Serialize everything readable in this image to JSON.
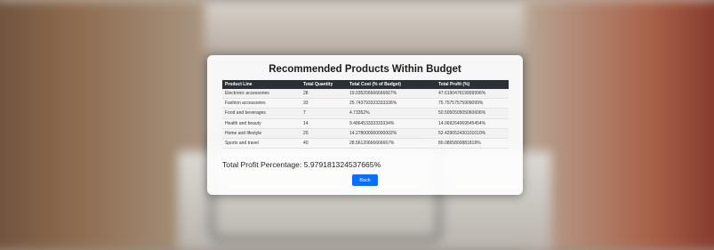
{
  "page": {
    "title": "Recommended Products Within Budget",
    "total_profit_label": "Total Profit Percentage: 5.979181324537665%",
    "back_label": "Back"
  },
  "table": {
    "headers": [
      "Product Line",
      "Total Quantity",
      "Total Cost (% of Budget)",
      "Total Profit (%)"
    ],
    "rows": [
      [
        "Electronic accessories",
        "28",
        "19.035206666666667%",
        "47.619047619999996%"
      ],
      [
        "Fashion accessories",
        "33",
        "25.743793333333336%",
        "75.75757575909099%"
      ],
      [
        "Food and beverages",
        "7",
        "4.73352%",
        "50.505050505060606%"
      ],
      [
        "Health and beauty",
        "14",
        "9.486453333333334%",
        "14.069264069545454%"
      ],
      [
        "Home and lifestyle",
        "20",
        "14.278000000000002%",
        "52.429052430101010%"
      ],
      [
        "Sports and travel",
        "40",
        "28.56120666666667%",
        "80.0865800881818%"
      ]
    ]
  },
  "colors": {
    "header_bg": "#2c3036",
    "button_bg": "#0d6efd"
  }
}
